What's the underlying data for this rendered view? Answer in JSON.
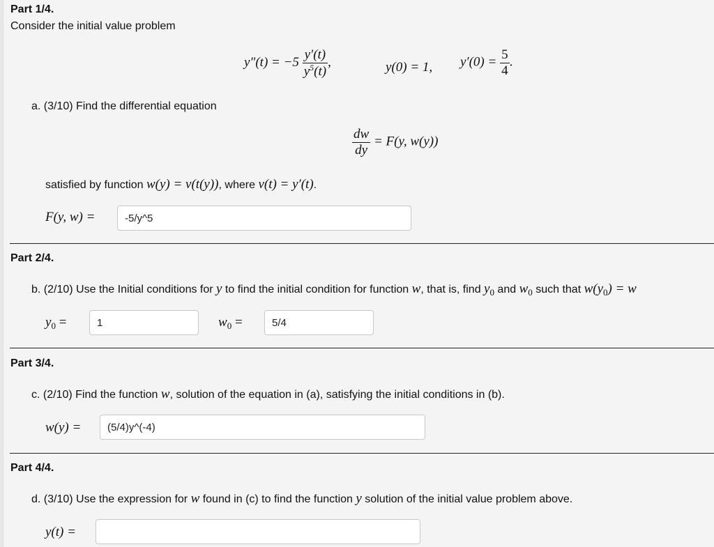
{
  "part1": {
    "title": "Part 1/4.",
    "intro": "Consider the initial value problem",
    "equation": {
      "lhs": "y″(t) = −5",
      "frac_num": "y′(t)",
      "frac_den_base": "y",
      "frac_den_exp": "5",
      "frac_den_tail": "(t)",
      "comma": ",",
      "ic1": "y(0) = 1,",
      "ic2_lhs": "y′(0) =",
      "ic2_num": "5",
      "ic2_den": "4",
      "ic2_end": "."
    },
    "question_a": "a. (3/10) Find the differential equation",
    "de": {
      "num": "dw",
      "den": "dy",
      "rhs": "= F(y, w(y))"
    },
    "satisfied_text_1": "satisfied by function ",
    "satisfied_math_1": "w(y) = v(t(y))",
    "satisfied_text_2": ", where ",
    "satisfied_math_2": "v(t) = y′(t)",
    "satisfied_text_3": ".",
    "answer_label": "F(y, w) =",
    "answer_value": "-5/y^5"
  },
  "part2": {
    "title": "Part 2/4.",
    "q_text_1": "b. (2/10) Use the Initial conditions for ",
    "q_math_y": "y",
    "q_text_2": " to find the initial condition for function ",
    "q_math_w": "w",
    "q_text_3": ", that is, find ",
    "q_math_y0_base": "y",
    "q_math_y0_sub": "0",
    "q_text_4": " and ",
    "q_math_w0_base": "w",
    "q_math_w0_sub": "0",
    "q_text_5": " such that ",
    "q_math_tail": "w(y",
    "q_math_tail_sub": "0",
    "q_math_tail_end": ") = w",
    "y0_label_base": "y",
    "y0_label_sub": "0",
    "y0_label_eq": " =",
    "y0_value": "1",
    "w0_label_base": "w",
    "w0_label_sub": "0",
    "w0_label_eq": " =",
    "w0_value": "5/4"
  },
  "part3": {
    "title": "Part 3/4.",
    "q_text_1": "c. (2/10) Find the function ",
    "q_math_w": "w",
    "q_text_2": ", solution of the equation in (a), satisfying the initial conditions in (b).",
    "answer_label": "w(y) =",
    "answer_value": "(5/4)y^(-4)"
  },
  "part4": {
    "title": "Part 4/4.",
    "q_text_1": "d. (3/10) Use the expression for ",
    "q_math_w": "w",
    "q_text_2": " found in (c) to find the function ",
    "q_math_y": "y",
    "q_text_3": " solution of the initial value problem above.",
    "answer_label": "y(t) =",
    "answer_value": ""
  }
}
